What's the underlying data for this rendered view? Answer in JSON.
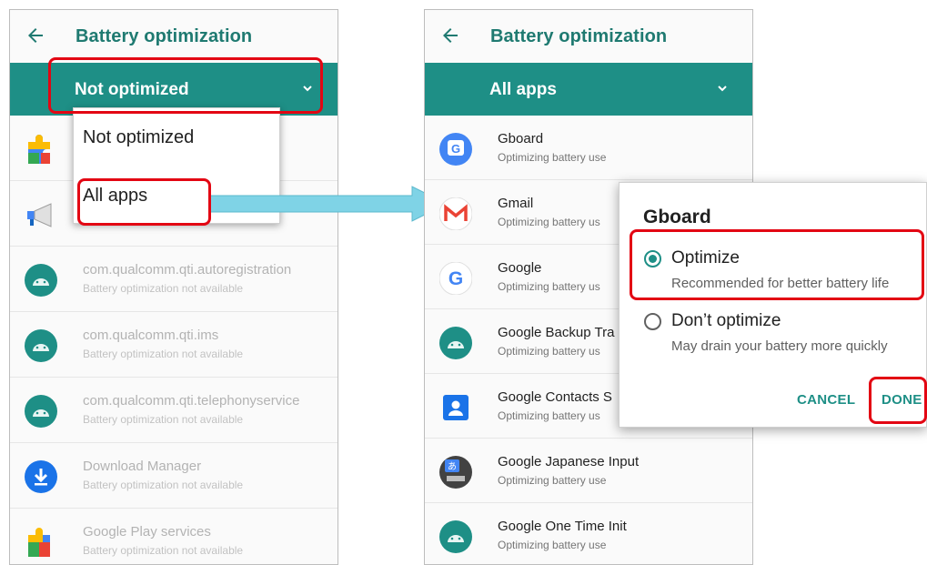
{
  "left_screen": {
    "title": "Battery optimization",
    "filter_label": "Not optimized",
    "dropdown": {
      "items": [
        "Not optimized",
        "All apps"
      ]
    },
    "apps": [
      {
        "title": "",
        "subtitle": "",
        "icon": "puzzle-icon"
      },
      {
        "title": "",
        "subtitle": "",
        "icon": "megaphone-icon"
      },
      {
        "title": "com.qualcomm.qti.autoregistration",
        "subtitle": "Battery optimization not available",
        "icon": "android-icon"
      },
      {
        "title": "com.qualcomm.qti.ims",
        "subtitle": "Battery optimization not available",
        "icon": "android-icon"
      },
      {
        "title": "com.qualcomm.qti.telephonyservice",
        "subtitle": "Battery optimization not available",
        "icon": "android-icon"
      },
      {
        "title": "Download Manager",
        "subtitle": "Battery optimization not available",
        "icon": "download-icon"
      },
      {
        "title": "Google Play services",
        "subtitle": "Battery optimization not available",
        "icon": "puzzle-icon"
      }
    ]
  },
  "right_screen": {
    "title": "Battery optimization",
    "filter_label": "All apps",
    "apps": [
      {
        "title": "Gboard",
        "subtitle": "Optimizing battery use",
        "icon": "gboard-icon"
      },
      {
        "title": "Gmail",
        "subtitle": "Optimizing battery us",
        "icon": "gmail-icon"
      },
      {
        "title": "Google",
        "subtitle": "Optimizing battery us",
        "icon": "google-icon"
      },
      {
        "title": "Google Backup Tra",
        "subtitle": "Optimizing battery us",
        "icon": "android-icon"
      },
      {
        "title": "Google Contacts S",
        "subtitle": "Optimizing battery us",
        "icon": "contacts-icon"
      },
      {
        "title": "Google Japanese Input",
        "subtitle": "Optimizing battery use",
        "icon": "japanese-input-icon"
      },
      {
        "title": "Google One Time Init",
        "subtitle": "Optimizing battery use",
        "icon": "android-icon"
      }
    ]
  },
  "dialog": {
    "title": "Gboard",
    "option_optimize": {
      "label": "Optimize",
      "description": "Recommended for better battery life",
      "selected": true
    },
    "option_dont": {
      "label": "Don’t optimize",
      "description": "May drain your battery more quickly",
      "selected": false
    },
    "cancel_label": "CANCEL",
    "done_label": "DONE"
  },
  "colors": {
    "accent": "#1e8f86",
    "title_text": "#1f7a71",
    "highlight": "#e30613",
    "connector": "#7fd3e6"
  }
}
